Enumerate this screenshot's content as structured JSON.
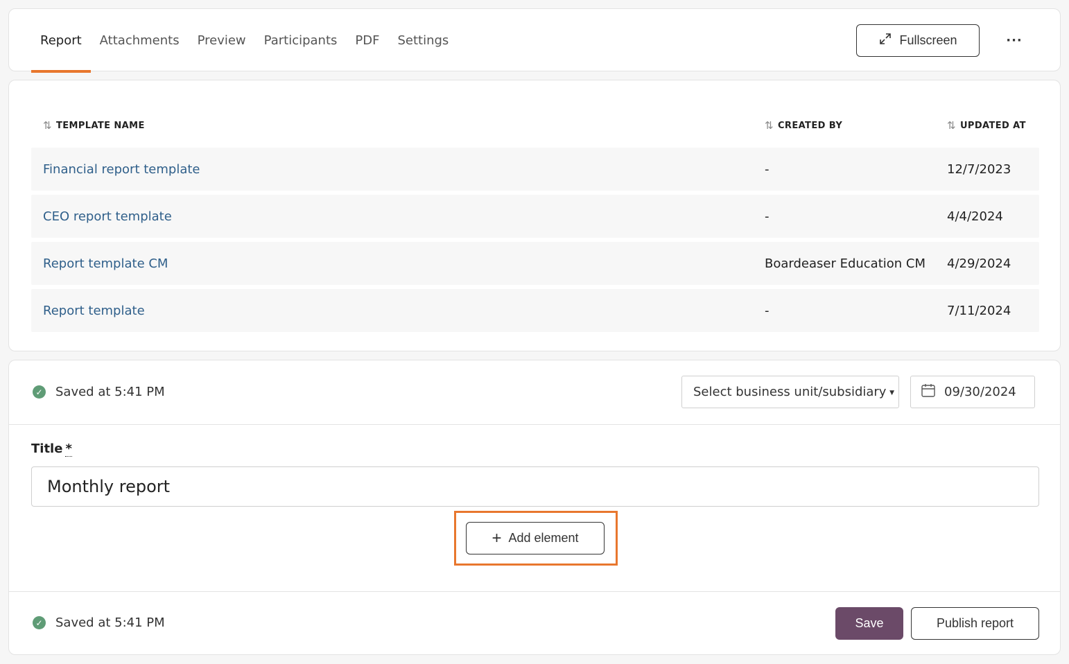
{
  "tabs": [
    {
      "label": "Report",
      "active": true
    },
    {
      "label": "Attachments",
      "active": false
    },
    {
      "label": "Preview",
      "active": false
    },
    {
      "label": "Participants",
      "active": false
    },
    {
      "label": "PDF",
      "active": false
    },
    {
      "label": "Settings",
      "active": false
    }
  ],
  "toolbar": {
    "fullscreen_label": "Fullscreen",
    "more_label": "···"
  },
  "table": {
    "columns": [
      "TEMPLATE NAME",
      "CREATED BY",
      "UPDATED AT"
    ],
    "rows": [
      {
        "name": "Financial report template",
        "created_by": "-",
        "updated_at": "12/7/2023"
      },
      {
        "name": "CEO report template",
        "created_by": "-",
        "updated_at": "4/4/2024"
      },
      {
        "name": "Report template CM",
        "created_by": "Boardeaser Education CM",
        "updated_at": "4/29/2024"
      },
      {
        "name": "Report template",
        "created_by": "-",
        "updated_at": "7/11/2024"
      }
    ]
  },
  "editor": {
    "saved_status": "Saved at 5:41 PM",
    "business_unit_placeholder": "Select business unit/subsidiary",
    "date": "09/30/2024",
    "title_label": "Title",
    "required_mark": "*",
    "title_value": "Monthly report",
    "add_element_label": "Add element",
    "footer_saved_status": "Saved at 5:41 PM",
    "save_label": "Save",
    "publish_label": "Publish report"
  },
  "colors": {
    "accent": "#e8772e",
    "primary_button": "#6b4a68",
    "link": "#2f5f8a",
    "success": "#5f9c76"
  }
}
